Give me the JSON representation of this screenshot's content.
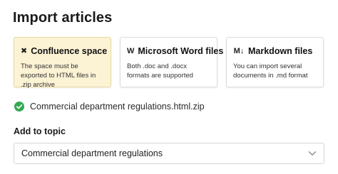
{
  "page": {
    "title": "Import articles"
  },
  "sources": [
    {
      "icon": "confluence-icon",
      "icon_glyph": "✖",
      "title": "Confluence space",
      "description": "The space must be exported to HTML files in .zip archive",
      "selected": true
    },
    {
      "icon": "word-icon",
      "icon_glyph": "W",
      "title": "Microsoft Word files",
      "description": "Both .doc and .docx formats are supported",
      "selected": false
    },
    {
      "icon": "markdown-icon",
      "icon_glyph": "M↓",
      "title": "Markdown files",
      "description": "You can import several documents in .md format",
      "selected": false
    }
  ],
  "upload": {
    "status_icon": "check-circle-icon",
    "file_name": "Commercial department regulations.html.zip"
  },
  "topic": {
    "label": "Add to topic",
    "selected_value": "Commercial department regulations"
  },
  "colors": {
    "selected_card_bg": "#fcf2d4",
    "selected_card_border": "#e9d9a2",
    "success_green": "#35a853",
    "card_border": "#dcdcdc"
  }
}
